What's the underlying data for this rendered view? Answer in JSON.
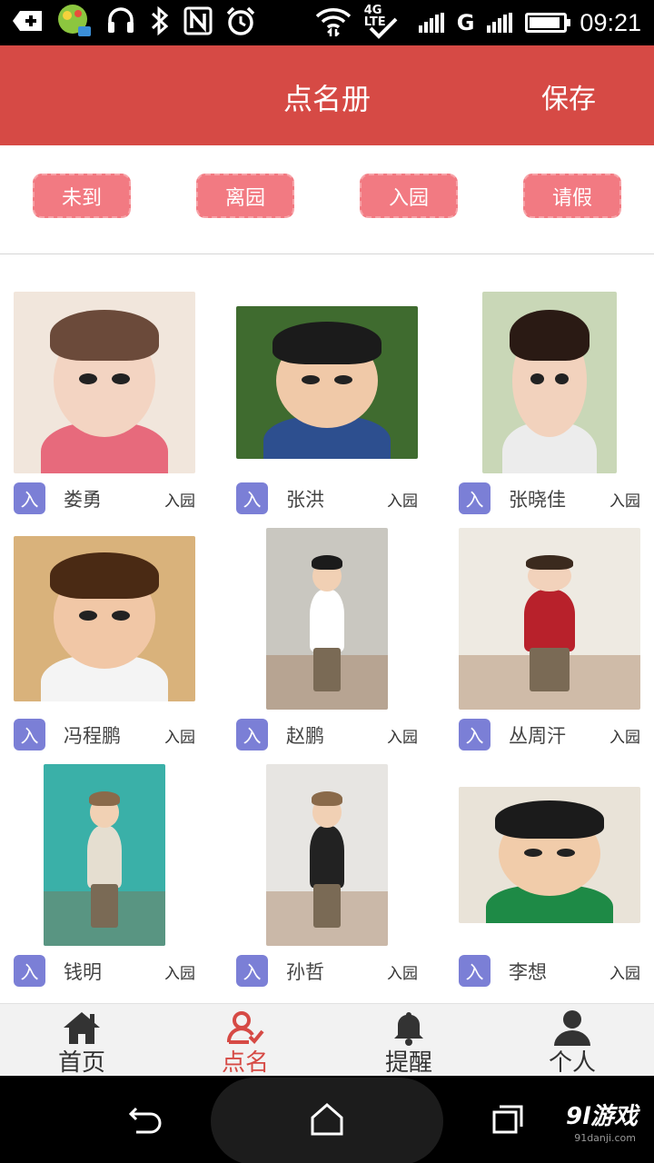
{
  "status_bar": {
    "network_label": "4G LTE",
    "g_label": "G",
    "battery_level": 0.9,
    "time": "09:21"
  },
  "header": {
    "title": "点名册",
    "save_label": "保存"
  },
  "filters": [
    {
      "label": "未到"
    },
    {
      "label": "离园"
    },
    {
      "label": "入园"
    },
    {
      "label": "请假"
    }
  ],
  "children": [
    {
      "name": "娄勇",
      "badge": "入",
      "status": "入园",
      "photo_colors": [
        "#f1e6dc",
        "#f3d4c2",
        "#6b4a3a",
        "#e76a7c"
      ],
      "pose": "portrait"
    },
    {
      "name": "张洪",
      "badge": "入",
      "status": "入园",
      "photo_colors": [
        "#3f6b2f",
        "#f0c9a8",
        "#1b1b1b",
        "#2d4f8f"
      ],
      "pose": "portrait"
    },
    {
      "name": "张晓佳",
      "badge": "入",
      "status": "入园",
      "photo_colors": [
        "#c9d7b7",
        "#f2d2bd",
        "#2a1a14",
        "#ececec"
      ],
      "pose": "portrait"
    },
    {
      "name": "冯程鹏",
      "badge": "入",
      "status": "入园",
      "photo_colors": [
        "#d9b27b",
        "#f1c7a6",
        "#4a2a14",
        "#f4f4f4"
      ],
      "pose": "portrait"
    },
    {
      "name": "赵鹏",
      "badge": "入",
      "status": "入园",
      "photo_colors": [
        "#c9c7c0",
        "#f1d0b4",
        "#1b1b1b",
        "#ffffff"
      ],
      "pose": "standing"
    },
    {
      "name": "丛周汗",
      "badge": "入",
      "status": "入园",
      "photo_colors": [
        "#eeeae2",
        "#f2d2bb",
        "#3b2a1e",
        "#b8212b"
      ],
      "pose": "standing"
    },
    {
      "name": "钱明",
      "badge": "入",
      "status": "入园",
      "photo_colors": [
        "#3ab0a8",
        "#f1d1b4",
        "#8a6a4a",
        "#e5ded0"
      ],
      "pose": "standing"
    },
    {
      "name": "孙哲",
      "badge": "入",
      "status": "入园",
      "photo_colors": [
        "#e7e5e2",
        "#f1d0b4",
        "#8a6a4a",
        "#222222"
      ],
      "pose": "standing"
    },
    {
      "name": "李想",
      "badge": "入",
      "status": "入园",
      "photo_colors": [
        "#e9e3d8",
        "#f1ccaa",
        "#1b1b1b",
        "#1e8a46"
      ],
      "pose": "portrait"
    }
  ],
  "tabs": [
    {
      "label": "首页",
      "icon": "home-icon",
      "active": false
    },
    {
      "label": "点名",
      "icon": "rollcall-icon",
      "active": true
    },
    {
      "label": "提醒",
      "icon": "bell-icon",
      "active": false
    },
    {
      "label": "个人",
      "icon": "person-icon",
      "active": false
    }
  ],
  "nav_bar": {
    "watermark": "9l游戏",
    "watermark_sub": "91danji.com"
  },
  "colors": {
    "header": "#d64a45",
    "filter_button": "#f27a82",
    "badge": "#7b7fd6",
    "active_tab": "#d64a45"
  }
}
